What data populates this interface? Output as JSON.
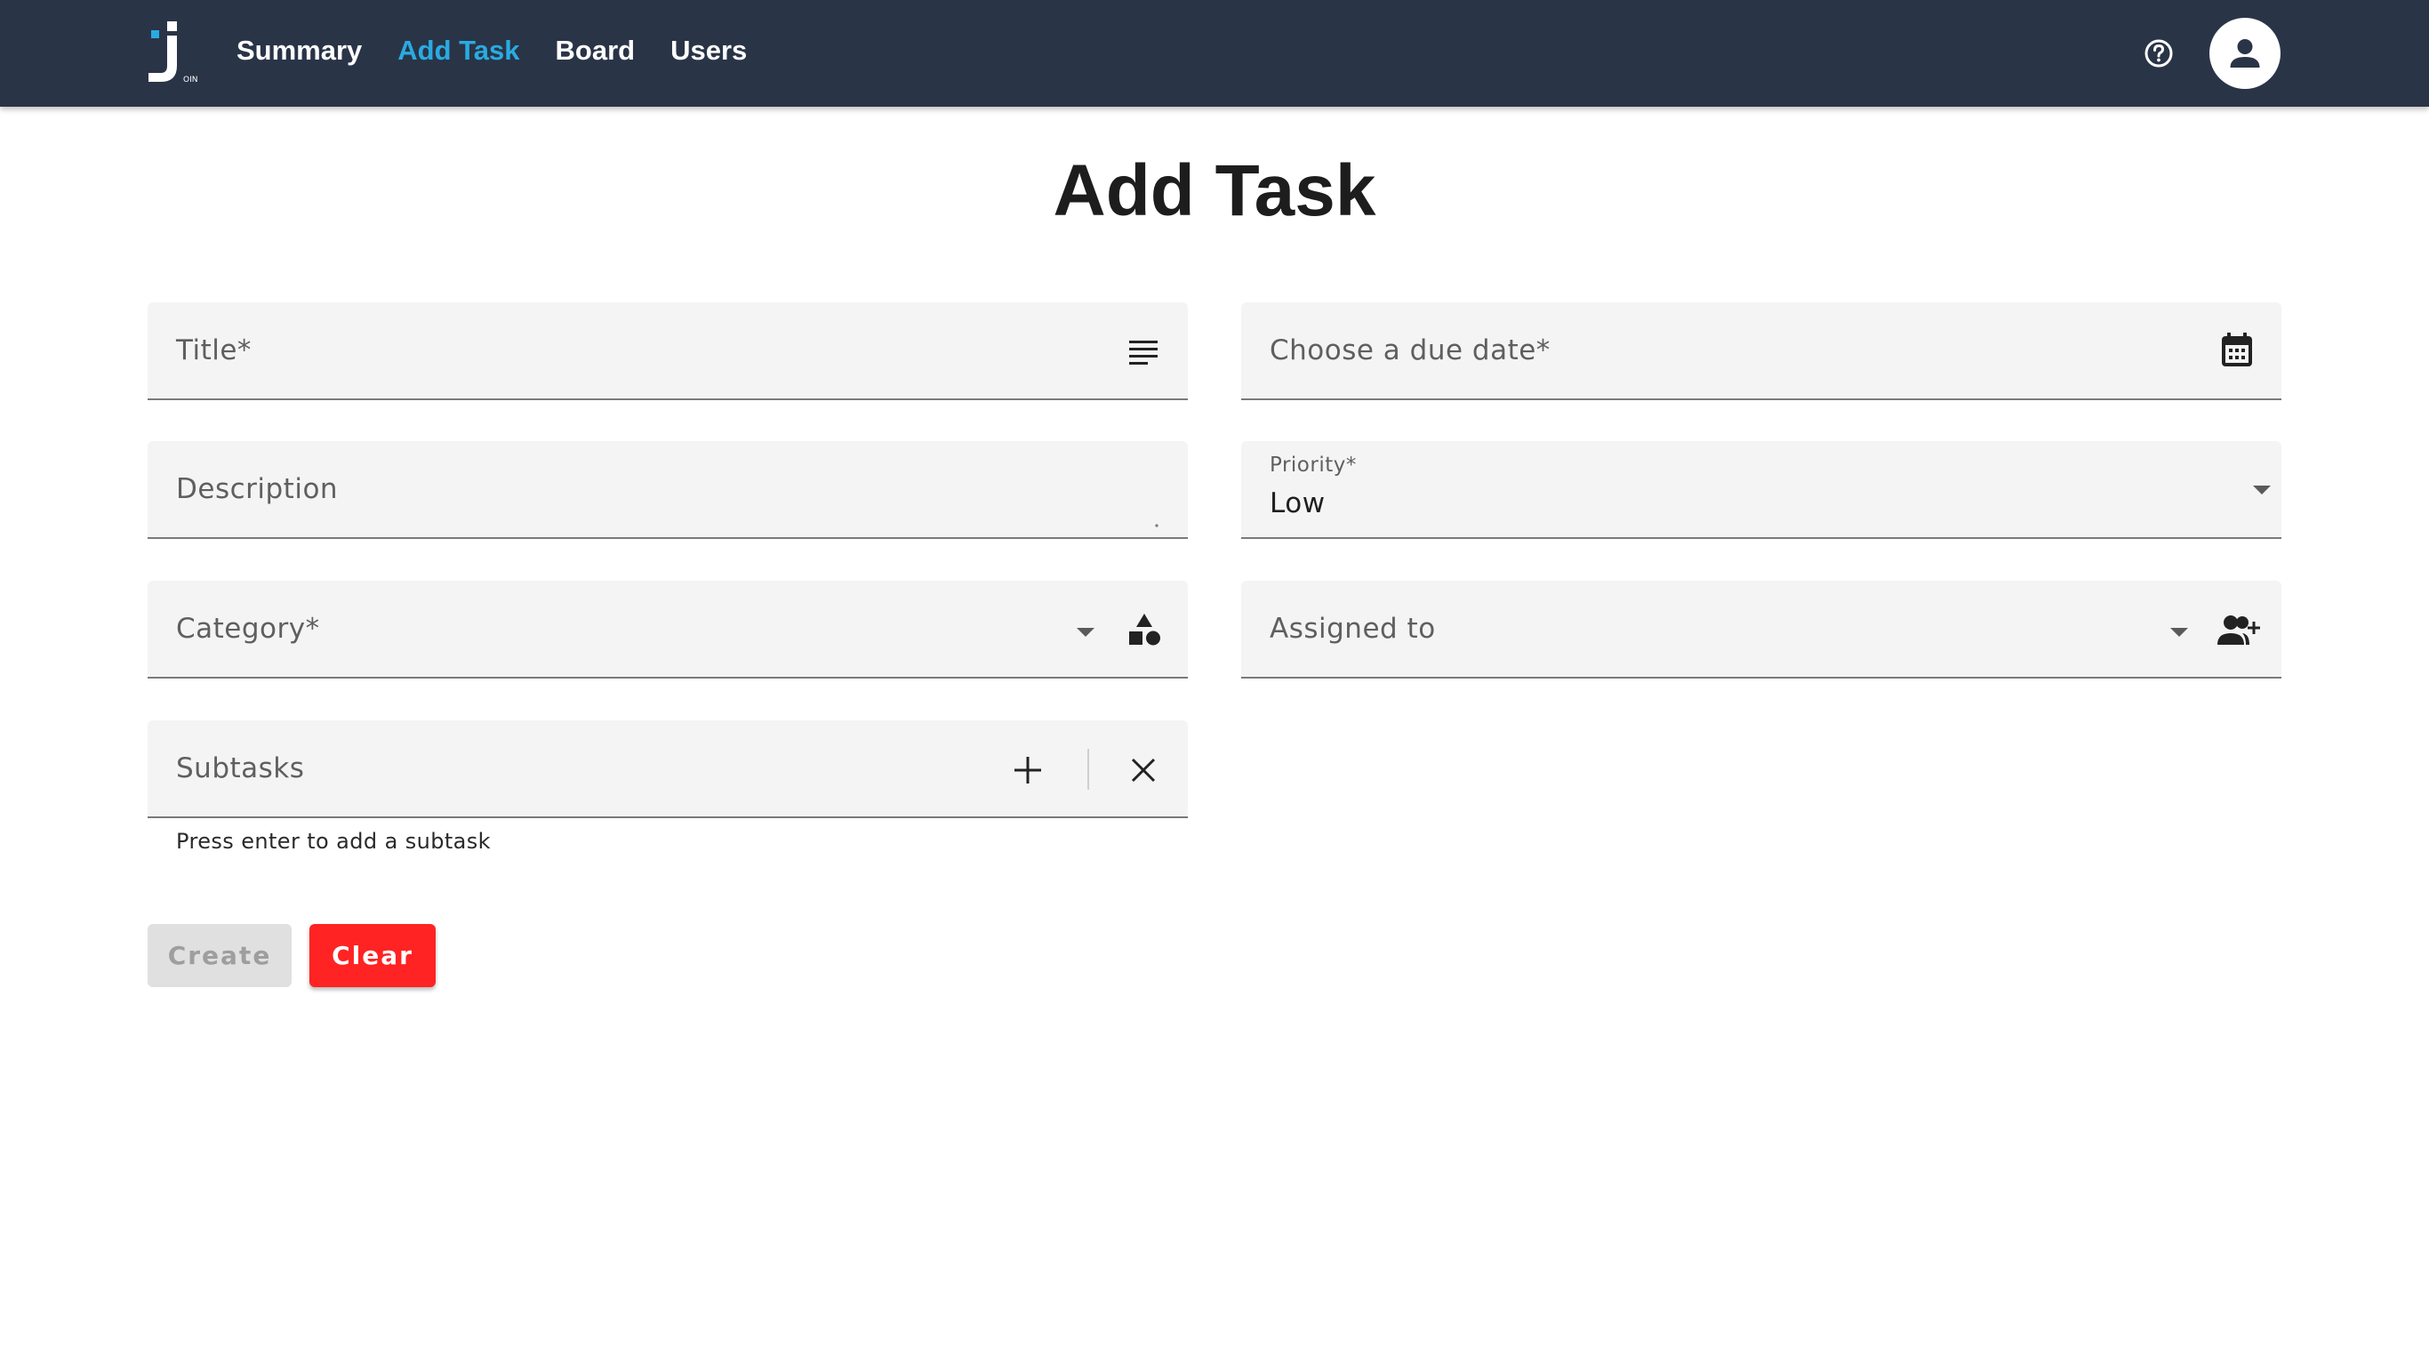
{
  "nav": {
    "items": [
      {
        "label": "Summary",
        "active": false
      },
      {
        "label": "Add Task",
        "active": true
      },
      {
        "label": "Board",
        "active": false
      },
      {
        "label": "Users",
        "active": false
      }
    ],
    "logo_icon": "join-logo",
    "help_icon": "help-circle-icon",
    "avatar_icon": "account-icon"
  },
  "page": {
    "title": "Add Task"
  },
  "form": {
    "title_field": {
      "label": "Title*",
      "value": "",
      "icon": "notes-icon"
    },
    "description_field": {
      "label": "Description",
      "value": ""
    },
    "category_field": {
      "label": "Category*",
      "value": "",
      "icon": "category-icon"
    },
    "subtasks_field": {
      "label": "Subtasks",
      "value": "",
      "hint": "Press enter to add a subtask",
      "add_icon": "plus-icon",
      "clear_icon": "close-icon"
    },
    "due_date_field": {
      "label": "Choose a due date*",
      "value": "",
      "icon": "calendar-icon"
    },
    "priority_field": {
      "label": "Priority*",
      "value": "Low"
    },
    "assigned_field": {
      "label": "Assigned to",
      "value": "",
      "icon": "person-add-icon"
    }
  },
  "buttons": {
    "create_label": "Create",
    "clear_label": "Clear",
    "create_disabled": true
  },
  "colors": {
    "topbar": "#2a3447",
    "accent": "#29abe2",
    "danger": "#ff2323"
  }
}
